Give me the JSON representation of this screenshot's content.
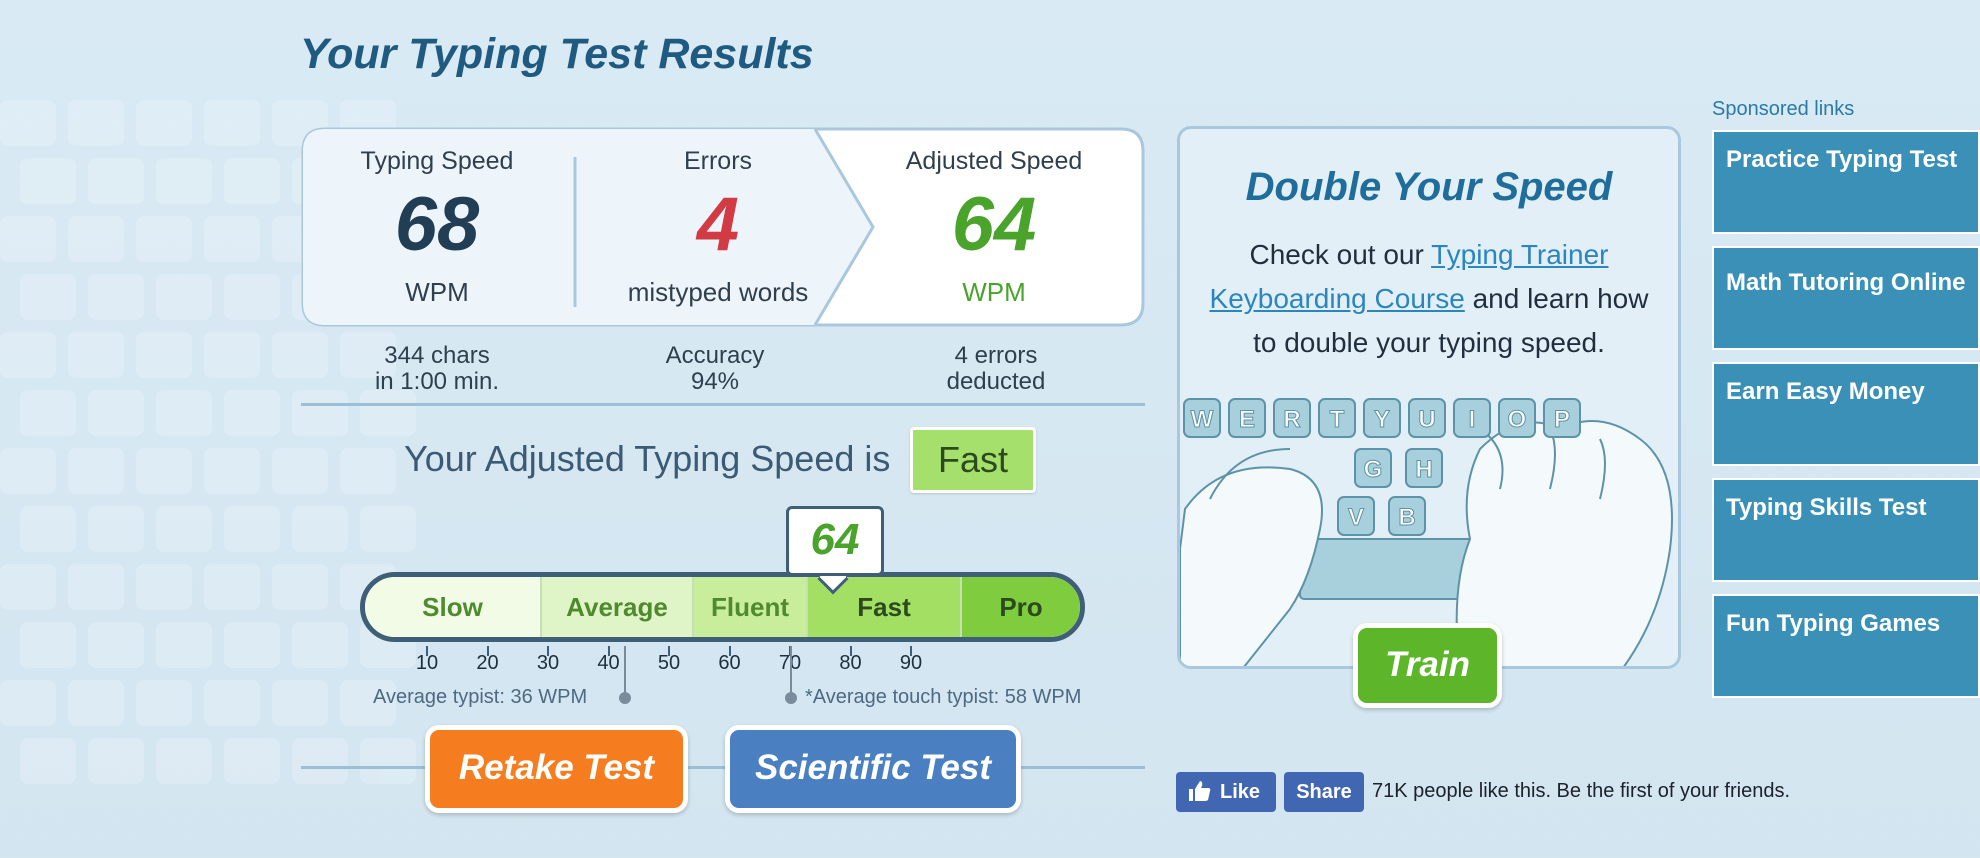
{
  "page_title": "Your Typing Test Results",
  "stats": {
    "typing_speed": {
      "label": "Typing Speed",
      "value": "68",
      "unit": "WPM"
    },
    "errors": {
      "label": "Errors",
      "value": "4",
      "unit": "mistyped words"
    },
    "adjusted_speed": {
      "label": "Adjusted Speed",
      "value": "64",
      "unit": "WPM"
    }
  },
  "sub_stats": {
    "chars": "344 chars",
    "time": "in 1:00 min.",
    "accuracy_label": "Accuracy",
    "accuracy_value": "94%",
    "errors_line1": "4 errors",
    "errors_line2": "deducted"
  },
  "rating": {
    "text": "Your Adjusted Typing Speed is",
    "value": "Fast"
  },
  "scale": {
    "pointer_value": "64",
    "segments": [
      {
        "label": "Slow",
        "color": "#f1fbe6",
        "text_color": "#4f8a2e"
      },
      {
        "label": "Average",
        "color": "#dff5c7",
        "text_color": "#4f8a2e"
      },
      {
        "label": "Fluent",
        "color": "#c8ee9c",
        "text_color": "#4f8a2e"
      },
      {
        "label": "Fast",
        "color": "#a2df63",
        "text_color": "#2b4a1e"
      },
      {
        "label": "Pro",
        "color": "#7fcd3f",
        "text_color": "#2b4a1e"
      }
    ],
    "ticks": [
      "10",
      "20",
      "30",
      "40",
      "50",
      "60",
      "70",
      "80",
      "90"
    ],
    "average_typist": "Average typist: 36 WPM",
    "average_touch_typist": "*Average touch typist: 58 WPM"
  },
  "buttons": {
    "retake": "Retake Test",
    "scientific": "Scientific Test"
  },
  "promo": {
    "title": "Double Your Speed",
    "text_before": "Check out our ",
    "link": "Typing Trainer Keyboarding Course",
    "text_after": " and learn how to double your typing speed.",
    "keys_row1": [
      "W",
      "E",
      "R",
      "T",
      "Y",
      "U",
      "I",
      "O",
      "P"
    ],
    "keys_row2": [
      "G",
      "H"
    ],
    "keys_row3": [
      "V",
      "B"
    ],
    "train_button": "Train"
  },
  "facebook": {
    "like": "Like",
    "share": "Share",
    "text": "71K people like this. Be the first of your friends."
  },
  "sponsored": {
    "title": "Sponsored links",
    "ads": [
      "Practice Typing Test",
      "Math Tutoring Online",
      "Earn Easy Money",
      "Typing Skills Test",
      "Fun Typing Games"
    ]
  }
}
